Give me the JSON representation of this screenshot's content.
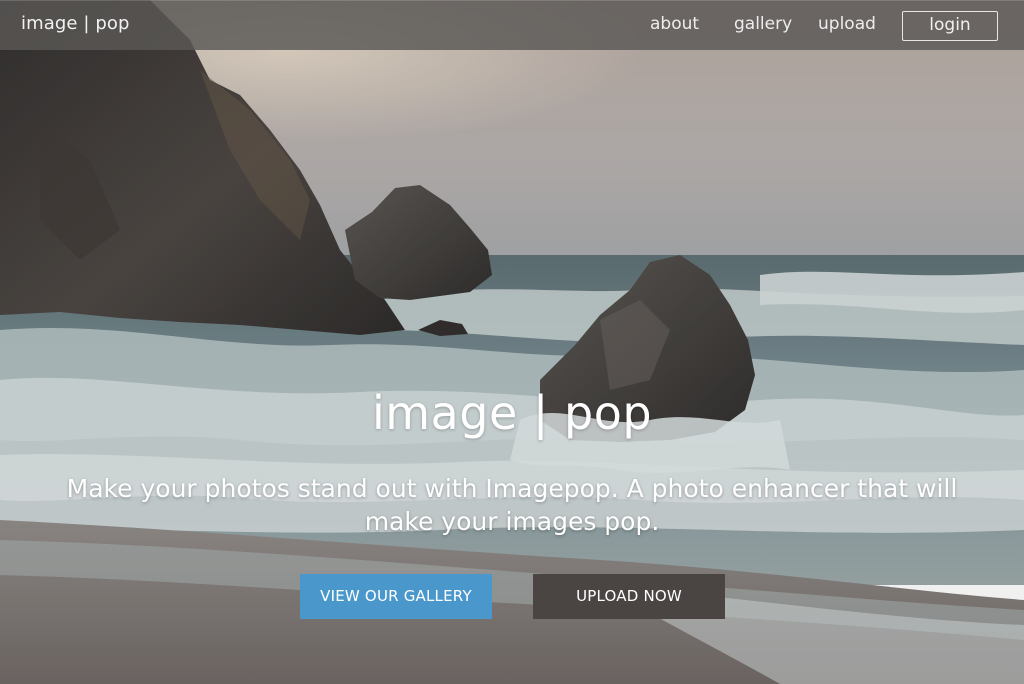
{
  "navbar": {
    "brand": "image | pop",
    "links": [
      {
        "label": "about"
      },
      {
        "label": "gallery"
      },
      {
        "label": "upload"
      }
    ],
    "login_label": "login"
  },
  "hero": {
    "background": "seascape-photo",
    "title": "image | pop",
    "tagline": "Make your photos stand out with Imagepop.  A photo enhancer that will make your images pop.",
    "buttons": {
      "gallery_label": "VIEW OUR GALLERY",
      "upload_label": "UPLOAD NOW"
    }
  },
  "colors": {
    "navbar_bg": "#5a5856",
    "gallery_button": "#4a97cc",
    "upload_button": "#4a4443",
    "text": "#ffffff"
  }
}
